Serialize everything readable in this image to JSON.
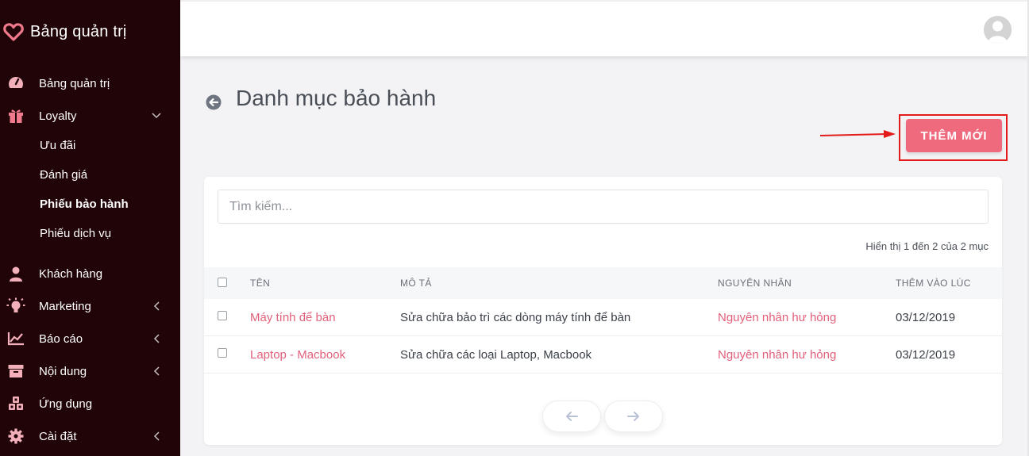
{
  "brand": {
    "title": "Bảng quản trị",
    "accent": "#f06a7e"
  },
  "sidebar": {
    "items": [
      {
        "label": "Bảng quản trị",
        "icon": "dashboard-icon"
      },
      {
        "label": "Loyalty",
        "icon": "gift-icon",
        "expanded": true,
        "children": [
          {
            "label": "Ưu đãi"
          },
          {
            "label": "Đánh giá"
          },
          {
            "label": "Phiếu bảo hành",
            "active": true
          },
          {
            "label": "Phiếu dịch vụ"
          }
        ]
      },
      {
        "label": "Khách hàng",
        "icon": "user-icon"
      },
      {
        "label": "Marketing",
        "icon": "bulb-icon"
      },
      {
        "label": "Báo cáo",
        "icon": "chart-icon"
      },
      {
        "label": "Nội dung",
        "icon": "archive-icon"
      },
      {
        "label": "Ứng dụng",
        "icon": "cubes-icon"
      },
      {
        "label": "Cài đặt",
        "icon": "gear-icon"
      }
    ]
  },
  "page": {
    "title": "Danh mục bảo hành",
    "add_button": "THÊM MỚI"
  },
  "table": {
    "search_placeholder": "Tìm kiếm...",
    "showing": "Hiển thị 1 đến 2 của 2 mục",
    "columns": [
      "TÊN",
      "MÔ TẢ",
      "NGUYÊN NHÂN",
      "THÊM VÀO LÚC"
    ],
    "rows": [
      {
        "name": "Máy tính để bàn",
        "description": "Sửa chữa bảo trì các dòng máy tính để bàn",
        "cause": "Nguyên nhân hư hỏng",
        "added_at": "03/12/2019"
      },
      {
        "name": "Laptop - Macbook",
        "description": "Sửa chữa các loại Laptop, Macbook",
        "cause": "Nguyên nhân hư hỏng",
        "added_at": "03/12/2019"
      }
    ]
  }
}
